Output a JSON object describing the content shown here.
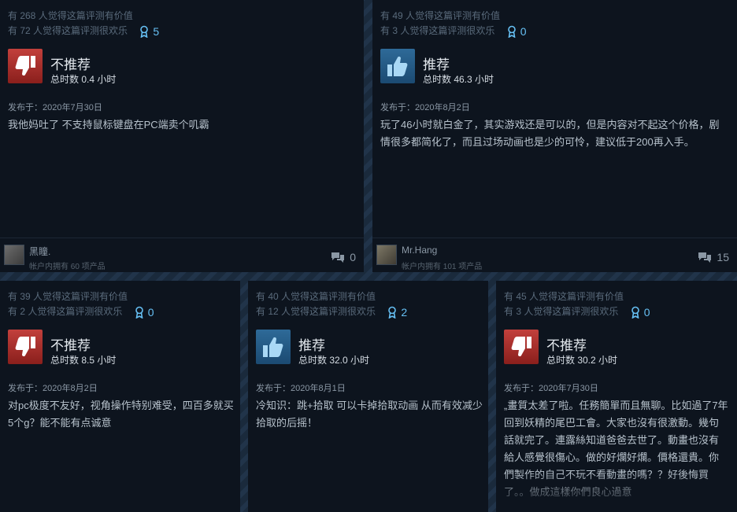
{
  "reviews": [
    {
      "helpful": "有 268 人觉得这篇评测有价值",
      "funny": "有 72 人觉得这篇评测很欢乐",
      "awards": "5",
      "recommended": false,
      "verdict": "不推荐",
      "hours": "总时数 0.4 小时",
      "posted": "发布于：2020年7月30日",
      "text": "我他妈吐了 不支持鼠标键盘在PC端卖个叽霸",
      "user": {
        "name": "黑瞳.",
        "owned": "帐户内拥有 60 项产品"
      },
      "comments": "0"
    },
    {
      "helpful": "有 49 人觉得这篇评测有价值",
      "funny": "有 3 人觉得这篇评测很欢乐",
      "awards": "0",
      "recommended": true,
      "verdict": "推荐",
      "hours": "总时数 46.3 小时",
      "posted": "发布于：2020年8月2日",
      "text": "玩了46小时就白金了，其实游戏还是可以的，但是内容对不起这个价格，剧情很多都简化了，而且过场动画也是少的可怜，建议低于200再入手。",
      "user": {
        "name": "Mr.Hang",
        "owned": "帐户内拥有 101 项产品"
      },
      "comments": "15"
    },
    {
      "helpful": "有 39 人觉得这篇评测有价值",
      "funny": "有 2 人觉得这篇评测很欢乐",
      "awards": "0",
      "recommended": false,
      "verdict": "不推荐",
      "hours": "总时数 8.5 小时",
      "posted": "发布于：2020年8月2日",
      "text": "对pc极度不友好，视角操作特别难受，四百多就买5个g？能不能有点诚意"
    },
    {
      "helpful": "有 40 人觉得这篇评测有价值",
      "funny": "有 12 人觉得这篇评测很欢乐",
      "awards": "2",
      "recommended": true,
      "verdict": "推荐",
      "hours": "总时数 32.0 小时",
      "posted": "发布于：2020年8月1日",
      "text": "冷知识：跳+拾取 可以卡掉拾取动画 从而有效减少拾取的后摇！"
    },
    {
      "helpful": "有 45 人觉得这篇评测有价值",
      "funny": "有 3 人觉得这篇评测很欢乐",
      "awards": "0",
      "recommended": false,
      "verdict": "不推荐",
      "hours": "总时数 30.2 小时",
      "posted": "发布于：2020年7月30日",
      "text": "„畫質太差了啦。任務簡單而且無聊。比如過了7年回到妖精的尾巴工會。大家也沒有很激動。幾句話就完了。連露絲知道爸爸去世了。動畫也沒有給人感覺很傷心。做的好爛好爛。價格還貴。你們製作的自己不玩不看動畫的嗎？？好後悔買了。。做成這樣你們良心過意"
    }
  ],
  "icons": {
    "thumb_down": "thumbs-down-icon",
    "thumb_up": "thumbs-up-icon",
    "award": "award-ribbon-icon",
    "comment": "comment-bubbles-icon"
  },
  "colors": {
    "negative": "#a8322e",
    "positive": "#25587f",
    "award": "#66c0f4"
  }
}
